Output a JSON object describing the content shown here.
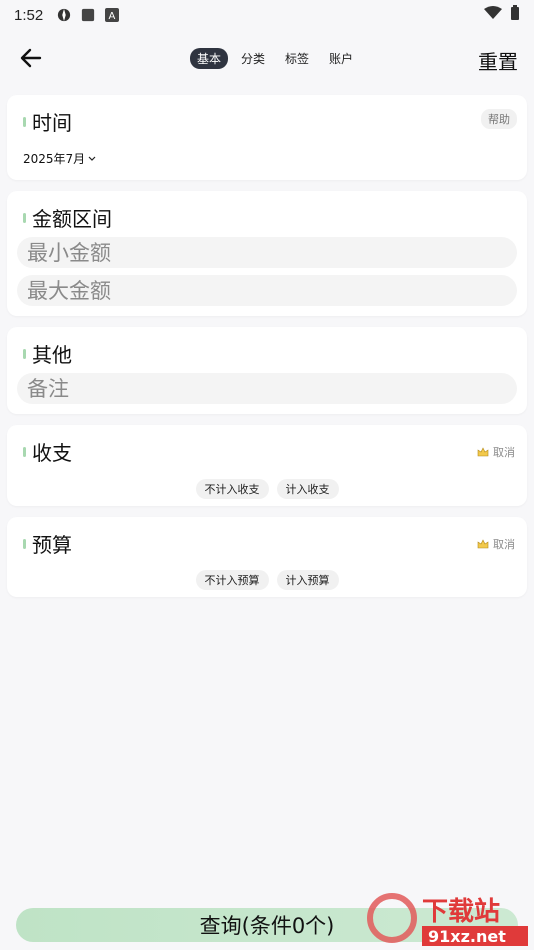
{
  "status": {
    "time": "1:52"
  },
  "topbar": {
    "tabs": [
      {
        "label": "基本",
        "active": true
      },
      {
        "label": "分类"
      },
      {
        "label": "标签"
      },
      {
        "label": "账户"
      }
    ],
    "reset_label": "重置"
  },
  "time_card": {
    "title": "时间",
    "help_label": "帮助",
    "month_value": "2025年7月"
  },
  "amount_card": {
    "title": "金额区间",
    "min_placeholder": "最小金额",
    "max_placeholder": "最大金额"
  },
  "other_card": {
    "title": "其他",
    "note_placeholder": "备注"
  },
  "income_card": {
    "title": "收支",
    "cancel_label": "取消",
    "chips": [
      "不计入收支",
      "计入收支"
    ]
  },
  "budget_card": {
    "title": "预算",
    "cancel_label": "取消",
    "chips": [
      "不计入预算",
      "计入预算"
    ]
  },
  "query_label": "查询(条件0个)",
  "watermark": {
    "text_cn": "下载站",
    "text_en": "91xz.net"
  },
  "colors": {
    "accent_green": "#bfe3c6",
    "active_tab": "#2f3440",
    "mark": "#a8d8b0"
  }
}
